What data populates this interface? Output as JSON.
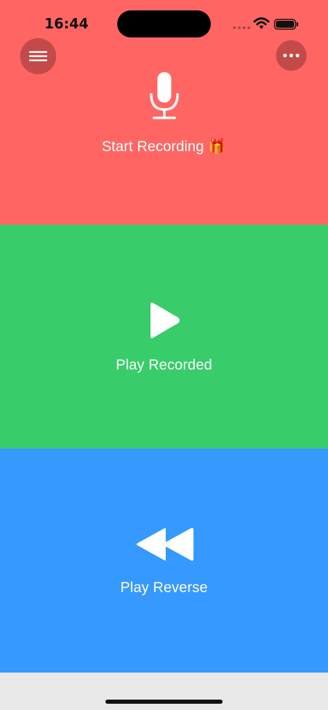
{
  "status_bar": {
    "time": "16:44"
  },
  "header": {
    "menu_icon": "hamburger-menu-icon",
    "more_icon": "more-dots-icon"
  },
  "panels": {
    "record": {
      "label": "Start Recording 🎁",
      "icon": "microphone-icon",
      "color": "#ff6663"
    },
    "play": {
      "label": "Play Recorded",
      "icon": "play-icon",
      "color": "#38cc6a"
    },
    "reverse": {
      "label": "Play Reverse",
      "icon": "rewind-icon",
      "color": "#3699fe"
    }
  },
  "colors": {
    "bottom_bar": "#e8e8e8",
    "text": "#ffffff"
  }
}
